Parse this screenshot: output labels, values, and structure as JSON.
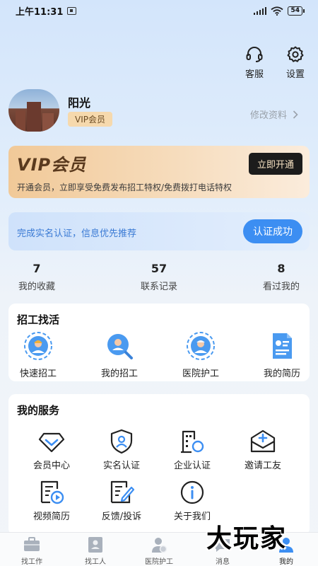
{
  "status_bar": {
    "time": "上午11:31",
    "battery": "54"
  },
  "header": {
    "service_label": "客服",
    "settings_label": "设置"
  },
  "profile": {
    "name": "阳光",
    "badge": "VIP会员",
    "edit_label": "修改资料"
  },
  "vip_card": {
    "title": "VIP会员",
    "button": "立即开通",
    "description": "开通会员，立即享受免费发布招工特权/免费拨打电话特权"
  },
  "auth_card": {
    "text": "完成实名认证，信息优先推荐",
    "button": "认证成功"
  },
  "stats": [
    {
      "value": "7",
      "label": "我的收藏"
    },
    {
      "value": "57",
      "label": "联系记录"
    },
    {
      "value": "8",
      "label": "看过我的"
    }
  ],
  "recruit": {
    "title": "招工找活",
    "items": [
      {
        "label": "快速招工",
        "icon": "worker-avatar-icon"
      },
      {
        "label": "我的招工",
        "icon": "search-person-icon"
      },
      {
        "label": "医院护工",
        "icon": "nurse-avatar-icon"
      },
      {
        "label": "我的简历",
        "icon": "resume-icon"
      }
    ]
  },
  "services": {
    "title": "我的服务",
    "items": [
      {
        "label": "会员中心",
        "icon": "diamond-icon"
      },
      {
        "label": "实名认证",
        "icon": "shield-user-icon"
      },
      {
        "label": "企业认证",
        "icon": "building-check-icon"
      },
      {
        "label": "邀请工友",
        "icon": "invite-mail-icon"
      },
      {
        "label": "视频简历",
        "icon": "video-resume-icon"
      },
      {
        "label": "反馈/投诉",
        "icon": "feedback-edit-icon"
      },
      {
        "label": "关于我们",
        "icon": "info-icon"
      }
    ]
  },
  "bottom_nav": [
    {
      "label": "找工作",
      "icon": "briefcase-icon"
    },
    {
      "label": "找工人",
      "icon": "worker-card-icon"
    },
    {
      "label": "医院护工",
      "icon": "nurse-icon"
    },
    {
      "label": "消息",
      "icon": "message-icon"
    },
    {
      "label": "我的",
      "icon": "profile-icon",
      "active": true
    }
  ],
  "watermark": "大玩家",
  "colors": {
    "accent": "#3c8ef2",
    "vip_gold": "#f1c998",
    "dark_button": "#1c1c1c"
  }
}
